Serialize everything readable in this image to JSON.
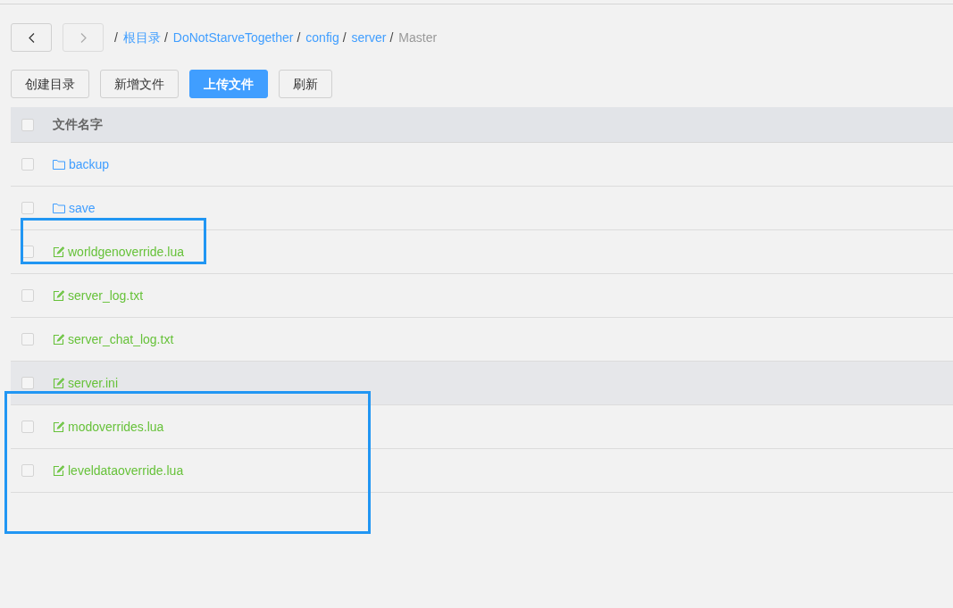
{
  "breadcrumb": [
    {
      "label": "根目录",
      "link": true
    },
    {
      "label": "DoNotStarveTogether",
      "link": true
    },
    {
      "label": "config",
      "link": true
    },
    {
      "label": "server",
      "link": true
    },
    {
      "label": "Master",
      "link": false
    }
  ],
  "separator": "/",
  "actions": [
    {
      "label": "创建目录",
      "primary": false
    },
    {
      "label": "新增文件",
      "primary": false
    },
    {
      "label": "上传文件",
      "primary": true
    },
    {
      "label": "刷新",
      "primary": false
    }
  ],
  "table": {
    "header": {
      "label": "文件名字",
      "checked": false
    },
    "rows": [
      {
        "kind": "folder",
        "name": "backup",
        "checked": false,
        "highlighted": false
      },
      {
        "kind": "folder",
        "name": "save",
        "checked": false,
        "highlighted": false
      },
      {
        "kind": "file",
        "name": "worldgenoverride.lua",
        "checked": false,
        "highlighted": false
      },
      {
        "kind": "file",
        "name": "server_log.txt",
        "checked": false,
        "highlighted": false
      },
      {
        "kind": "file",
        "name": "server_chat_log.txt",
        "checked": false,
        "highlighted": false
      },
      {
        "kind": "file",
        "name": "server.ini",
        "checked": false,
        "highlighted": true
      },
      {
        "kind": "file",
        "name": "modoverrides.lua",
        "checked": false,
        "highlighted": false
      },
      {
        "kind": "file",
        "name": "leveldataoverride.lua",
        "checked": false,
        "highlighted": false
      }
    ]
  }
}
